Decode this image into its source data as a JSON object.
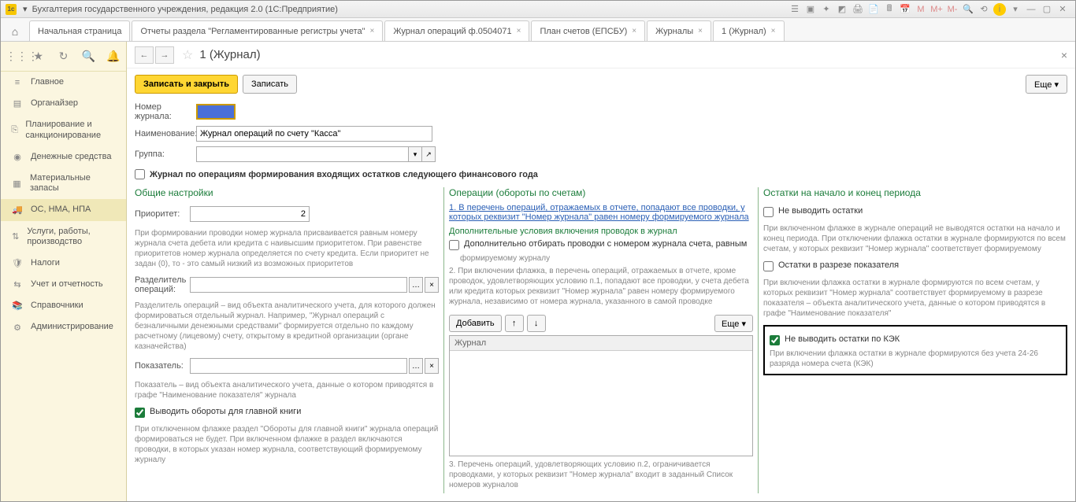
{
  "titlebar": {
    "text": "Бухгалтерия государственного учреждения, редакция 2.0  (1С:Предприятие)"
  },
  "tabs": {
    "start": "Начальная страница",
    "items": [
      "Отчеты раздела \"Регламентированные регистры учета\"",
      "Журнал операций ф.0504071",
      "План счетов (ЕПСБУ)",
      "Журналы",
      "1 (Журнал)"
    ]
  },
  "sidebar": {
    "items": [
      {
        "icon": "≡",
        "label": "Главное"
      },
      {
        "icon": "▤",
        "label": "Органайзер"
      },
      {
        "icon": "⎘",
        "label": "Планирование и санкционирование"
      },
      {
        "icon": "◉",
        "label": "Денежные средства"
      },
      {
        "icon": "▦",
        "label": "Материальные запасы"
      },
      {
        "icon": "🚚",
        "label": "ОС, НМА, НПА"
      },
      {
        "icon": "⇅",
        "label": "Услуги, работы, производство"
      },
      {
        "icon": "🛡",
        "label": "Налоги"
      },
      {
        "icon": "⇆",
        "label": "Учет и отчетность"
      },
      {
        "icon": "📚",
        "label": "Справочники"
      },
      {
        "icon": "⚙",
        "label": "Администрирование"
      }
    ]
  },
  "page": {
    "title": "1 (Журнал)",
    "btn_save_close": "Записать и закрыть",
    "btn_save": "Записать",
    "btn_more": "Еще ▾",
    "fld_number": "Номер журнала:",
    "fld_name": "Наименование:",
    "fld_name_val": "Журнал операций по счету \"Касса\"",
    "fld_group": "Группа:",
    "chk_year": "Журнал по операциям формирования входящих остатков следующего финансового года"
  },
  "col1": {
    "title": "Общие настройки",
    "priority_lbl": "Приоритет:",
    "priority_val": "2",
    "help1": "При формировании проводки номер журнала присваивается равным номеру журнала счета дебета или кредита с наивысшим приоритетом. При равенстве приоритетов номер журнала определяется по счету кредита. Если приоритет не задан (0), то - это самый низкий из возможных приоритетов",
    "sep_lbl": "Разделитель операций:",
    "help2": "Разделитель операций – вид объекта аналитического учета, для которого должен формироваться отдельный журнал. Например, \"Журнал операций с безналичными денежными средствами\" формируется отдельно по каждому расчетному (лицевому) счету, открытому в кредитной организации (органе казначейства)",
    "ind_lbl": "Показатель:",
    "help3": "Показатель – вид объекта аналитического учета, данные о котором приводятся в графе \"Наименование показателя\" журнала",
    "chk_main": "Выводить обороты для главной книги",
    "help4": "При отключенном флажке раздел \"Обороты для главной книги\" журнала операций формироваться не будет. При включенном флажке в раздел включаются проводки, в которых указан номер журнала, соответствующий формируемому журналу"
  },
  "col2": {
    "title": "Операции (обороты по счетам)",
    "link1": "1. В перечень операций, отражаемых в отчете, попадают все проводки, у которых реквизит \"Номер журнала\" равен номеру формируемого журнала",
    "subtitle": "Дополнительные условия включения проводок в журнал",
    "chk1": "Дополнительно отбирать проводки с номером журнала счета, равным",
    "chk1sub": "формируемому журналу",
    "help1": "2. При включении флажка, в перечень операций, отражаемых в отчете, кроме проводок, удовлетворяющих условию п.1, попадают все проводки, у счета дебета или кредита которых реквизит \"Номер журнала\" равен номеру формируемого журнала, независимо от номера журнала, указанного в самой проводке",
    "btn_add": "Добавить",
    "btn_more": "Еще ▾",
    "list_head": "Журнал",
    "help2": "3. Перечень операций, удовлетворяющих условию п.2, ограничивается проводками, у которых реквизит \"Номер журнала\" входит в заданный Список номеров журналов"
  },
  "col3": {
    "title": "Остатки на начало и конец периода",
    "chk1": "Не выводить остатки",
    "help1": "При включенном флажке в журнале операций не выводятся остатки на начало и конец периода. При отключении флажка остатки в журнале формируются по всем счетам, у которых реквизит \"Номер журнала\" соответствует формируемому",
    "chk2": "Остатки в разрезе показателя",
    "help2": "При включении флажка остатки в журнале формируются по всем счетам, у которых реквизит \"Номер журнала\" соответствует формируемому в разрезе показателя – объекта аналитического учета, данные о котором приводятся в графе \"Наименование показателя\"",
    "chk3": "Не выводить остатки по КЭК",
    "help3": "При включении флажка остатки в журнале формируются без учета 24-26 разряда номера счета (КЭК)"
  }
}
